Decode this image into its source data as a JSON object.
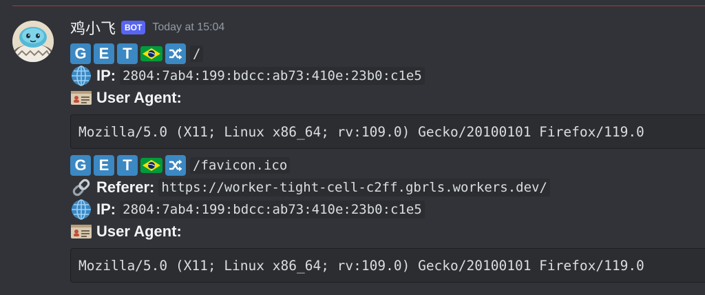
{
  "message": {
    "author": "鸡小飞",
    "bot_badge": "BOT",
    "timestamp": "Today at 15:04",
    "avatar_icon": "cartoon-bird-avatar"
  },
  "requests": [
    {
      "method_letters": [
        "G",
        "E",
        "T"
      ],
      "country_flag": "brazil-flag-icon",
      "path": "/",
      "ip_label": "IP:",
      "ip": "2804:7ab4:199:bdcc:ab73:410e:23b0:c1e5",
      "ua_label": "User Agent:",
      "user_agent": "Mozilla/5.0 (X11; Linux x86_64; rv:109.0) Gecko/20100101 Firefox/119.0"
    },
    {
      "method_letters": [
        "G",
        "E",
        "T"
      ],
      "country_flag": "brazil-flag-icon",
      "path": "/favicon.ico",
      "referer_label": "Referer:",
      "referer": "https://worker-tight-cell-c2ff.gbrls.workers.dev/",
      "ip_label": "IP:",
      "ip": "2804:7ab4:199:bdcc:ab73:410e:23b0:c1e5",
      "ua_label": "User Agent:",
      "user_agent": "Mozilla/5.0 (X11; Linux x86_64; rv:109.0) Gecko/20100101 Firefox/119.0"
    }
  ],
  "colors": {
    "background": "#313338",
    "divider": "#a13d41",
    "bot_badge": "#5865f2",
    "tile_blue": "#3b88c3",
    "code_bg": "#2b2d31"
  }
}
